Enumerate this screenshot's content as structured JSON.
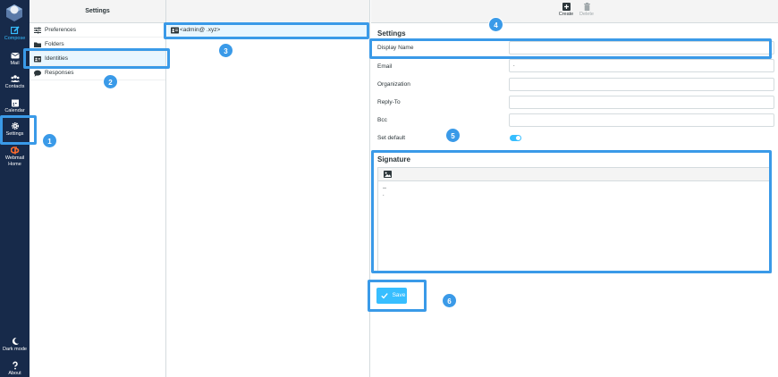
{
  "taskbar": {
    "compose": "Compose",
    "mail": "Mail",
    "contacts": "Contacts",
    "calendar": "Calendar",
    "settings": "Settings",
    "webmail_line1": "Webmail",
    "webmail_line2": "Home",
    "dark_mode": "Dark mode",
    "about": "About"
  },
  "settings_panel": {
    "title": "Settings",
    "items": [
      {
        "label": "Preferences",
        "icon": "sliders-icon"
      },
      {
        "label": "Folders",
        "icon": "folder-icon"
      },
      {
        "label": "Identities",
        "icon": "id-card-icon"
      },
      {
        "label": "Responses",
        "icon": "comment-icon"
      }
    ]
  },
  "identities": {
    "items": [
      {
        "label": "<admin@        .xyz>"
      }
    ]
  },
  "toolbar": {
    "create": "Create",
    "delete": "Delete"
  },
  "form": {
    "section_title": "Settings",
    "display_name_label": "Display Name",
    "display_name_value": "",
    "email_label": "Email",
    "email_value": "                    .",
    "organization_label": "Organization",
    "organization_value": "",
    "reply_to_label": "Reply-To",
    "reply_to_value": "",
    "bcc_label": "Bcc",
    "bcc_value": "",
    "set_default_label": "Set default",
    "set_default_on": true
  },
  "signature": {
    "title": "Signature",
    "text": "-- \n."
  },
  "save_label": "Save",
  "badges": [
    "1",
    "2",
    "3",
    "4",
    "5",
    "6"
  ],
  "colors": {
    "taskbar": "#172a4a",
    "accent": "#37beff",
    "highlight": "#3a9ae8"
  }
}
